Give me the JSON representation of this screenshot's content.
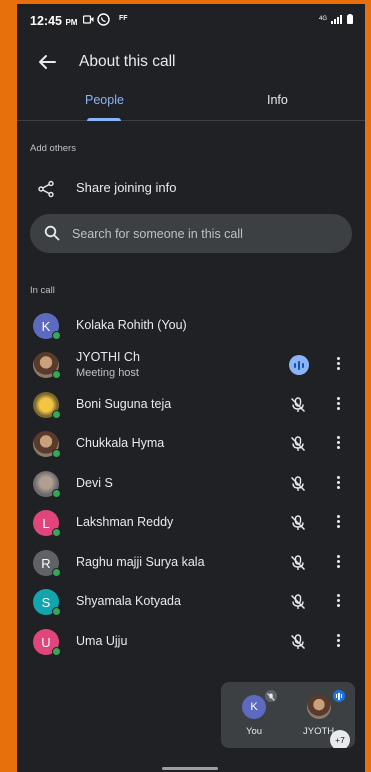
{
  "status_bar": {
    "time": "12:45",
    "ampm": "PM",
    "extra": "FF"
  },
  "header": {
    "title": "About this call"
  },
  "tabs": [
    {
      "label": "People"
    },
    {
      "label": "Info"
    }
  ],
  "add_others": {
    "heading": "Add others",
    "share_label": "Share joining info"
  },
  "search": {
    "placeholder": "Search for someone in this call"
  },
  "in_call": {
    "heading": "In call",
    "participants": [
      {
        "initial": "K",
        "color": "#5c6bc0",
        "name": "Kolaka Rohith (You)"
      },
      {
        "initial": "",
        "color": "",
        "name": "JYOTHI Ch",
        "role": "Meeting host"
      },
      {
        "initial": "",
        "color": "",
        "name": "Boni Suguna teja"
      },
      {
        "initial": "",
        "color": "",
        "name": "Chukkala Hyma"
      },
      {
        "initial": "",
        "color": "",
        "name": "Devi S"
      },
      {
        "initial": "L",
        "color": "#e0457b",
        "name": "Lakshman Reddy"
      },
      {
        "initial": "R",
        "color": "#5f6368",
        "name": "Raghu majji Surya kala"
      },
      {
        "initial": "S",
        "color": "#12a4af",
        "name": "Shyamala Kotyada"
      },
      {
        "initial": "U",
        "color": "#e0457b",
        "name": "Uma Ujju"
      }
    ]
  },
  "pip": {
    "you_initial": "K",
    "you_label": "You",
    "other_label": "JYOTH",
    "overflow": "+7"
  },
  "colors": {
    "accent": "#8ab4f8",
    "online": "#34a853",
    "background": "#202124"
  }
}
